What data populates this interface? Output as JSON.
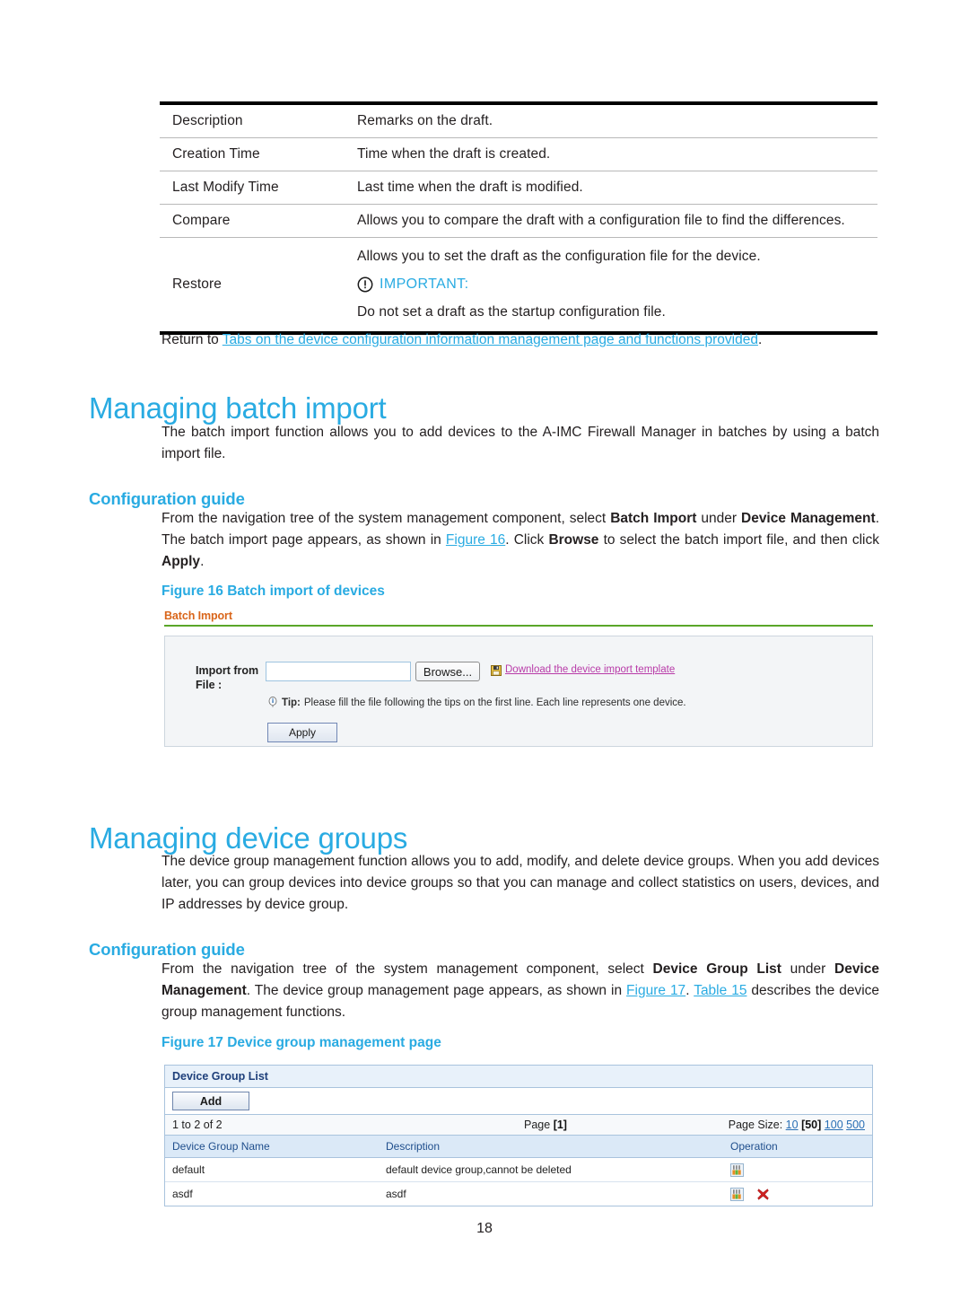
{
  "ref_table": {
    "rows": [
      {
        "term": "Description",
        "desc": "Remarks on the draft."
      },
      {
        "term": "Creation Time",
        "desc": "Time when the draft is created."
      },
      {
        "term": "Last Modify Time",
        "desc": "Last time when the draft is modified."
      },
      {
        "term": "Compare",
        "desc": "Allows you to compare the draft with a configuration file to find the differences."
      }
    ],
    "restore": {
      "term": "Restore",
      "line1": "Allows you to set the draft as the configuration file for the device.",
      "important_label": "IMPORTANT:",
      "line2": "Do not set a draft as the startup configuration file."
    }
  },
  "return_line": {
    "prefix": "Return to ",
    "link": "Tabs on the device configuration information management page and functions provided",
    "suffix": "."
  },
  "batch_import": {
    "heading": "Managing batch import",
    "intro": "The batch import function allows you to add devices to the A-IMC Firewall Manager in batches by using a batch import file.",
    "config_guide_heading": "Configuration guide",
    "guide": {
      "t1": "From the navigation tree of the system management component, select ",
      "b1": "Batch Import",
      "t2": " under ",
      "b2": "Device Management",
      "t3": ". The batch import page appears, as shown in ",
      "x1": "Figure 16",
      "t4": ". Click ",
      "b3": "Browse",
      "t5": " to select the batch import file, and then click ",
      "b4": "Apply",
      "t6": "."
    },
    "figure_caption": "Figure 16 Batch import of devices"
  },
  "figure16": {
    "panel_title": "Batch Import",
    "import_label": "Import from File :",
    "file_value": "",
    "file_placeholder": "",
    "browse_label": "Browse...",
    "download_link": "Download the device import template",
    "tip_strong": "Tip:",
    "tip_text": " Please fill the file following the tips on the first line. Each line represents one device.",
    "apply_label": "Apply",
    "colors": {
      "panel_title": "#d9651a",
      "rule": "#5aa629",
      "link": "#b83ba8"
    }
  },
  "device_groups": {
    "heading": "Managing device groups",
    "intro": "The device group management function allows you to add, modify, and delete device groups. When you add devices later, you can group devices into device groups so that you can manage and collect statistics on users, devices, and IP addresses by device group.",
    "config_guide_heading": "Configuration guide",
    "guide": {
      "t1": "From the navigation tree of the system management component, select ",
      "b1": "Device Group List",
      "t2": " under ",
      "b2": "Device Management",
      "t3": ". The device group management page appears, as shown in ",
      "x1": "Figure 17",
      "t4": ". ",
      "x2": "Table 15",
      "t5": " describes the device group management functions."
    },
    "figure_caption": "Figure 17 Device group management page"
  },
  "figure17": {
    "panel_title": "Device Group List",
    "add_label": "Add",
    "pager": {
      "range": "1 to 2 of 2",
      "page_label": "Page ",
      "page_current": "[1]",
      "size_label": "Page Size: ",
      "sizes": [
        "10",
        "50",
        "100",
        "500"
      ],
      "size_selected": "50"
    },
    "columns": [
      "Device Group Name",
      "Description",
      "Operation"
    ],
    "rows": [
      {
        "name": "default",
        "description": "default device group,cannot be deleted",
        "ops": [
          "modify-icon"
        ]
      },
      {
        "name": "asdf",
        "description": "asdf",
        "ops": [
          "modify-icon",
          "delete-icon"
        ]
      }
    ],
    "colors": {
      "title_text": "#1e3f7a",
      "title_bg": "#e8f1fa",
      "header_bg": "#dbe9f7",
      "link": "#2a6fb5"
    }
  },
  "footer": {
    "page_number": "18"
  },
  "theme": {
    "accent": "#29abe2",
    "text": "#231f20"
  }
}
